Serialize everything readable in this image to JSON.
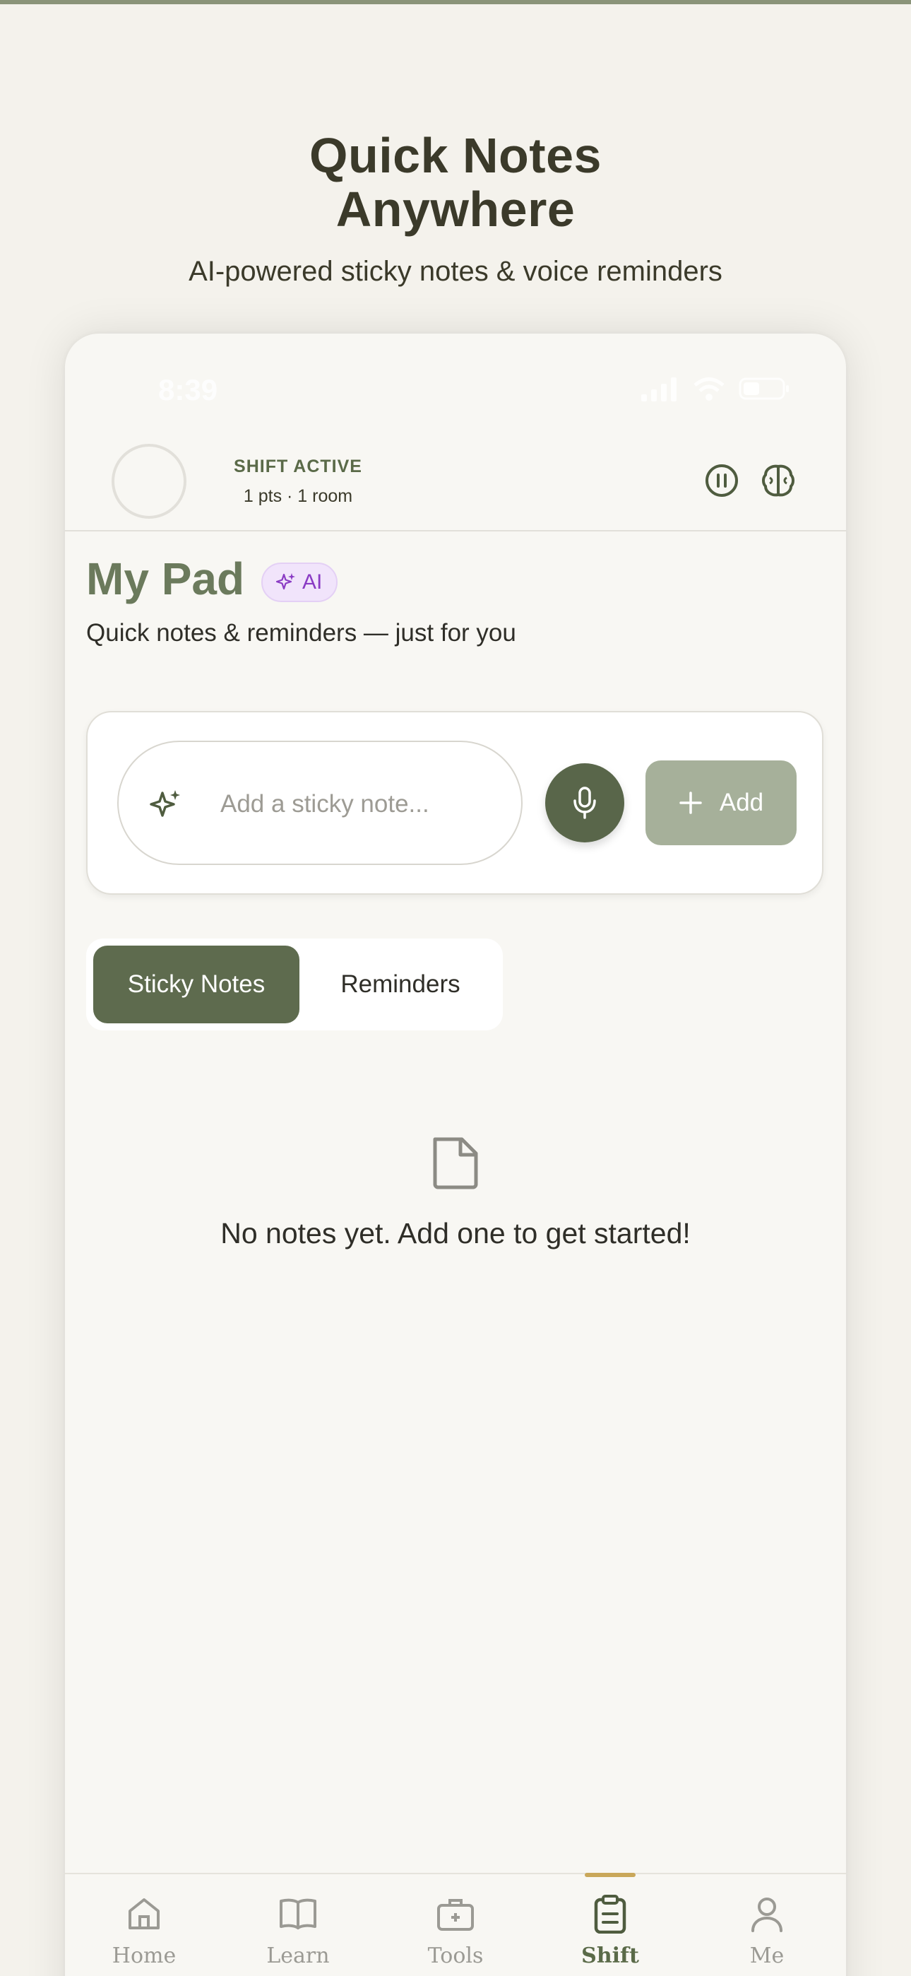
{
  "hero": {
    "title_line1": "Quick Notes",
    "title_line2": "Anywhere",
    "subtitle": "AI-powered sticky notes & voice reminders"
  },
  "status_bar": {
    "time": "8:39",
    "icons": [
      "signal-icon",
      "wifi-icon",
      "battery-icon"
    ]
  },
  "shift_header": {
    "status": "SHIFT ACTIVE",
    "meta": "1 pts · 1 room",
    "icons": [
      "pause-icon",
      "brain-icon"
    ]
  },
  "pad": {
    "title": "My Pad",
    "ai_badge": "AI",
    "subtitle": "Quick notes & reminders — just for you"
  },
  "composer": {
    "placeholder": "Add a sticky note...",
    "value": "",
    "add_label": "Add"
  },
  "tabs": {
    "items": [
      {
        "label": "Sticky Notes",
        "active": true
      },
      {
        "label": "Reminders",
        "active": false
      }
    ]
  },
  "empty_state": {
    "message": "No notes yet. Add one to get started!"
  },
  "bottom_nav": {
    "items": [
      {
        "label": "Home",
        "icon": "home-icon",
        "active": false
      },
      {
        "label": "Learn",
        "icon": "book-icon",
        "active": false
      },
      {
        "label": "Tools",
        "icon": "toolbox-icon",
        "active": false
      },
      {
        "label": "Shift",
        "icon": "clipboard-icon",
        "active": true
      },
      {
        "label": "Me",
        "icon": "user-icon",
        "active": false
      }
    ]
  },
  "colors": {
    "accent": "#5e6b4e",
    "accent_light": "#a6b09a",
    "ai_purple": "#8a3bc4",
    "nav_indicator": "#c9a75a",
    "background": "#f4f2ec"
  }
}
